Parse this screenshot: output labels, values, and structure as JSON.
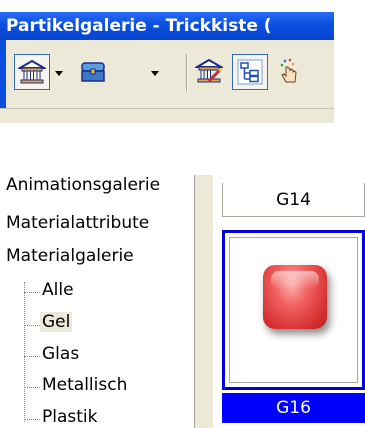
{
  "window": {
    "title": "Partikelgalerie - Trickkiste ("
  },
  "toolbar": {
    "buttons": [
      {
        "icon": "building-icon",
        "pressed": true,
        "has_dropdown": true
      },
      {
        "icon": "chest-icon",
        "pressed": false,
        "has_dropdown": true
      },
      {
        "icon": "building-edit-icon",
        "pressed": false,
        "has_dropdown": false
      },
      {
        "icon": "tree-view-icon",
        "pressed": true,
        "has_dropdown": false
      },
      {
        "icon": "hand-sparkle-icon",
        "pressed": false,
        "has_dropdown": false
      }
    ]
  },
  "tree": {
    "items": [
      "Animationsgalerie",
      "Materialattribute",
      "Materialgalerie"
    ],
    "children": [
      "Alle",
      "Gel",
      "Glas",
      "Metallisch",
      "Plastik"
    ],
    "selected_child": "Gel"
  },
  "gallery": {
    "top_label": "G14",
    "selected_label": "G16"
  },
  "colors": {
    "titlebar": "#0a4fe0",
    "selection": "#0000ff",
    "toolbar_bg": "#ece9d8",
    "gel_red": "#d63030"
  }
}
